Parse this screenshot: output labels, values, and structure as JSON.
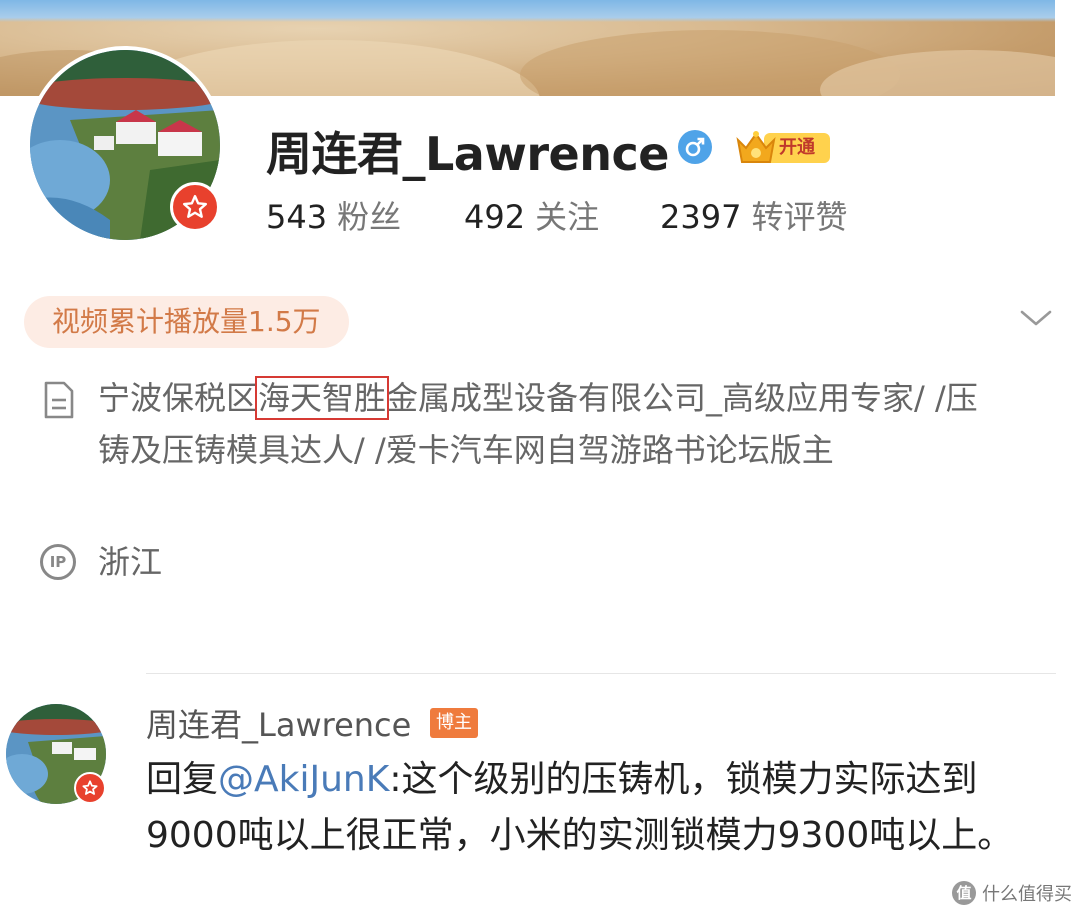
{
  "profile": {
    "username": "周连君_Lawrence",
    "vip_label": "开通",
    "stats": [
      {
        "num": "543",
        "label": "粉丝"
      },
      {
        "num": "492",
        "label": "关注"
      },
      {
        "num": "2397",
        "label": "转评赞"
      }
    ],
    "video_plays": "视频累计播放量1.5万",
    "bio_before": "宁波保税区",
    "bio_highlight": "海天智胜",
    "bio_after": "金属成型设备有限公司_高级应用专家/ /压铸及压铸模具达人/ /爱卡汽车网自驾游路书论坛版主",
    "ip_icon_text": "IP",
    "ip_location": "浙江"
  },
  "comment": {
    "author": "周连君_Lawrence",
    "tag": "博主",
    "prefix": "回复",
    "mention": "@AkiJunK",
    "text": ":这个级别的压铸机，锁模力实际达到9000吨以上很正常，小米的实测锁模力9300吨以上。"
  },
  "watermark": {
    "logo": "值",
    "text": "什么值得买"
  },
  "colors": {
    "accent_orange": "#d27a48",
    "mention_blue": "#4a7bb8",
    "badge_red": "#e8412d",
    "highlight_red": "#d63a34"
  }
}
